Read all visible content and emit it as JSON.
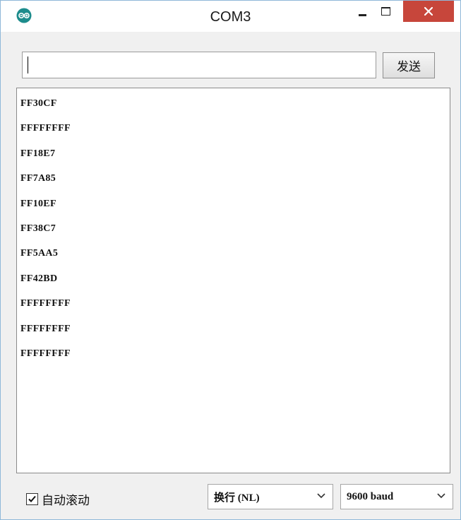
{
  "window": {
    "title": "COM3",
    "app_icon": "arduino-icon",
    "controls": {
      "minimize": "minimize-icon",
      "maximize": "maximize-icon",
      "close": "close-icon"
    },
    "close_color": "#c7463b"
  },
  "send_bar": {
    "input_value": "",
    "send_label": "发送"
  },
  "output": {
    "lines": [
      "FF30CF",
      "FFFFFFFF",
      "FF18E7",
      "FF7A85",
      "FF10EF",
      "FF38C7",
      "FF5AA5",
      "FF42BD",
      "FFFFFFFF",
      "FFFFFFFF",
      "FFFFFFFF"
    ]
  },
  "footer": {
    "autoscroll_label": "自动滚动",
    "autoscroll_checked": true,
    "line_ending": "换行 (NL)",
    "baud_rate": "9600 baud"
  }
}
